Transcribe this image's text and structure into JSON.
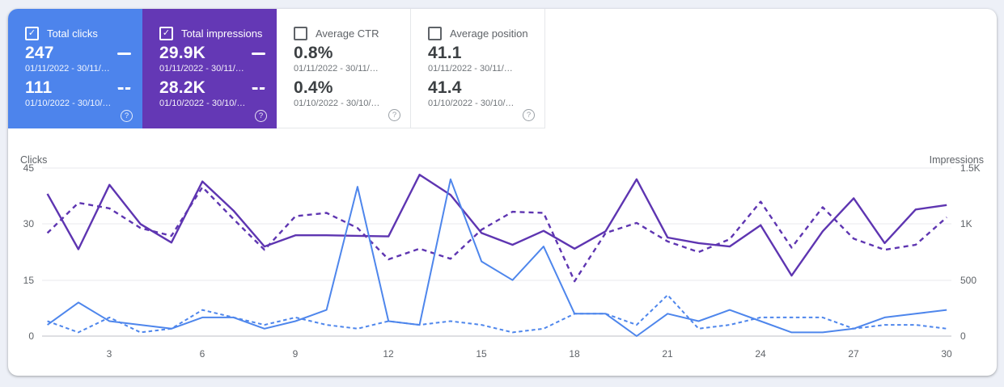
{
  "icons": {
    "check": "✓",
    "help": "?"
  },
  "colors": {
    "clicks_blue": "#4e86ec",
    "impressions_purple": "#5e35b1",
    "card_blue_bg": "#4d84ec",
    "card_purple_bg": "#6438b5",
    "page_bg": "#edf0f7"
  },
  "cards": [
    {
      "label": "Total clicks",
      "checked": true,
      "value_current": "247",
      "date_current": "01/11/2022 - 30/11/…",
      "value_previous": "111",
      "date_previous": "01/10/2022 - 30/10/…"
    },
    {
      "label": "Total impressions",
      "checked": true,
      "value_current": "29.9K",
      "date_current": "01/11/2022 - 30/11/…",
      "value_previous": "28.2K",
      "date_previous": "01/10/2022 - 30/10/…"
    },
    {
      "label": "Average CTR",
      "checked": false,
      "value_current": "0.8%",
      "date_current": "01/11/2022 - 30/11/…",
      "value_previous": "0.4%",
      "date_previous": "01/10/2022 - 30/10/…"
    },
    {
      "label": "Average position",
      "checked": false,
      "value_current": "41.1",
      "date_current": "01/11/2022 - 30/11/…",
      "value_previous": "41.4",
      "date_previous": "01/10/2022 - 30/10/…"
    }
  ],
  "chart": {
    "left_axis_title": "Clicks",
    "right_axis_title": "Impressions",
    "left_ticks": [
      "45",
      "30",
      "15",
      "0"
    ],
    "right_ticks": [
      "1.5K",
      "1K",
      "500",
      "0"
    ],
    "x_ticks": [
      "3",
      "6",
      "9",
      "12",
      "15",
      "18",
      "21",
      "24",
      "27",
      "30"
    ]
  },
  "chart_data": {
    "type": "line",
    "x": [
      1,
      2,
      3,
      4,
      5,
      6,
      7,
      8,
      9,
      10,
      11,
      12,
      13,
      14,
      15,
      16,
      17,
      18,
      19,
      20,
      21,
      22,
      23,
      24,
      25,
      26,
      27,
      28,
      29,
      30
    ],
    "x_axis_labeled_ticks": [
      3,
      6,
      9,
      12,
      15,
      18,
      21,
      24,
      27,
      30
    ],
    "y_left": {
      "title": "Clicks",
      "min": 0,
      "max": 45,
      "ticks": [
        0,
        15,
        30,
        45
      ]
    },
    "y_right": {
      "title": "Impressions",
      "min": 0,
      "max": 1500,
      "ticks": [
        0,
        500,
        1000,
        1500
      ]
    },
    "grid": true,
    "legend": "metric cards above act as legend; solid = current period, dashed = previous period",
    "series": [
      {
        "id": "impressions-previous",
        "metric": "Total impressions",
        "period": "01/10/2022 - 30/10/…",
        "axis": "right",
        "style": "dashed",
        "color": "#5e35b1",
        "total_shown": "28.2K",
        "values": [
          920,
          1190,
          1140,
          965,
          895,
          1330,
          1045,
          770,
          1070,
          1100,
          965,
          685,
          780,
          690,
          950,
          1110,
          1100,
          490,
          920,
          1010,
          845,
          750,
          865,
          1200,
          790,
          1150,
          870,
          770,
          815,
          1060
        ]
      },
      {
        "id": "impressions-current",
        "metric": "Total impressions",
        "period": "01/11/2022 - 30/11/…",
        "axis": "right",
        "style": "solid",
        "color": "#5e35b1",
        "total_shown": "29.9K",
        "values": [
          1270,
          775,
          1350,
          1000,
          835,
          1380,
          1120,
          800,
          900,
          900,
          895,
          890,
          1440,
          1260,
          920,
          815,
          940,
          780,
          935,
          1400,
          880,
          830,
          800,
          990,
          540,
          935,
          1230,
          830,
          1130,
          1170
        ]
      },
      {
        "id": "clicks-previous",
        "metric": "Total clicks",
        "period": "01/10/2022 - 30/10/…",
        "axis": "left",
        "style": "dashed",
        "color": "#4e86ec",
        "total_shown": "111",
        "values": [
          4,
          1,
          5,
          1,
          2,
          7,
          5,
          3,
          5,
          3,
          2,
          4,
          3,
          4,
          3,
          1,
          2,
          6,
          6,
          3,
          11,
          2,
          3,
          5,
          5,
          5,
          2,
          3,
          3,
          2
        ]
      },
      {
        "id": "clicks-current",
        "metric": "Total clicks",
        "period": "01/11/2022 - 30/11/…",
        "axis": "left",
        "style": "solid",
        "color": "#4e86ec",
        "total_shown": "247",
        "values": [
          3,
          9,
          4,
          3,
          2,
          5,
          5,
          2,
          4,
          7,
          40,
          4,
          3,
          42,
          20,
          15,
          24,
          6,
          6,
          0,
          6,
          4,
          7,
          4,
          1,
          1,
          2,
          5,
          6,
          7
        ]
      }
    ]
  }
}
